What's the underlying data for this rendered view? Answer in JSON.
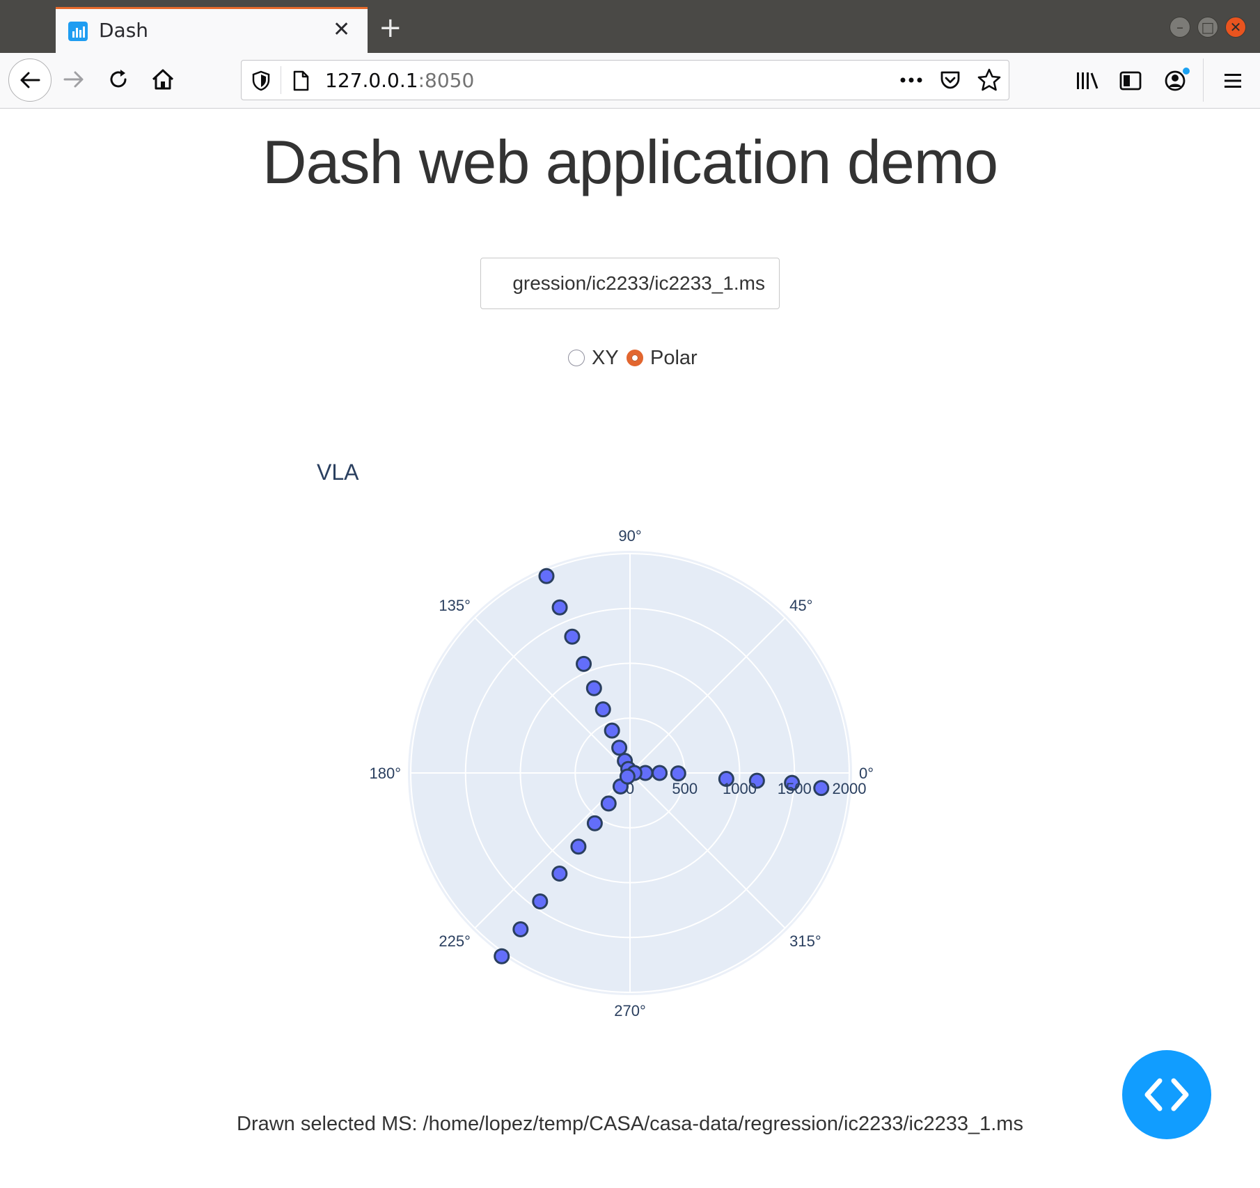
{
  "browser": {
    "tab_title": "Dash",
    "url_host": "127.0.0.1",
    "url_port": ":8050"
  },
  "page": {
    "title": "Dash web application demo",
    "ms_input_value": "gression/ic2233/ic2233_1.ms",
    "radio_options": [
      {
        "label": "XY",
        "selected": false
      },
      {
        "label": "Polar",
        "selected": true
      }
    ],
    "footer": "Drawn selected MS: /home/lopez/temp/CASA/casa-data/regression/ic2233/ic2233_1.ms"
  },
  "colors": {
    "marker_fill": "#636efa",
    "marker_line": "#2a3f5f",
    "polar_bg": "#e5ecf6",
    "accent": "#119dff"
  },
  "chart_data": {
    "type": "scatter",
    "projection": "polar",
    "title": "VLA",
    "radial_range": [
      0,
      2000
    ],
    "radial_ticks": [
      "0",
      "500",
      "1000",
      "1500",
      "2000"
    ],
    "angular_ticks": [
      "0°",
      "45°",
      "90°",
      "135°",
      "180°",
      "225°",
      "270°",
      "315°"
    ],
    "grid": true,
    "points": [
      {
        "r": 1950,
        "theta": 113
      },
      {
        "r": 1640,
        "theta": 113
      },
      {
        "r": 1350,
        "theta": 113
      },
      {
        "r": 1080,
        "theta": 113
      },
      {
        "r": 840,
        "theta": 113
      },
      {
        "r": 630,
        "theta": 113
      },
      {
        "r": 420,
        "theta": 113
      },
      {
        "r": 250,
        "theta": 113
      },
      {
        "r": 120,
        "theta": 113
      },
      {
        "r": 40,
        "theta": 113
      },
      {
        "r": 1750,
        "theta": -4.5
      },
      {
        "r": 1480,
        "theta": -3.5
      },
      {
        "r": 1160,
        "theta": -3.5
      },
      {
        "r": 880,
        "theta": -3.5
      },
      {
        "r": 440,
        "theta": -0.5
      },
      {
        "r": 270,
        "theta": 0
      },
      {
        "r": 140,
        "theta": 0
      },
      {
        "r": 40,
        "theta": 0
      },
      {
        "r": 2040,
        "theta": 235
      },
      {
        "r": 1740,
        "theta": 235
      },
      {
        "r": 1430,
        "theta": 235
      },
      {
        "r": 1120,
        "theta": 235
      },
      {
        "r": 820,
        "theta": 235
      },
      {
        "r": 560,
        "theta": 235
      },
      {
        "r": 340,
        "theta": 235
      },
      {
        "r": 150,
        "theta": 235
      },
      {
        "r": 40,
        "theta": 235
      }
    ]
  }
}
